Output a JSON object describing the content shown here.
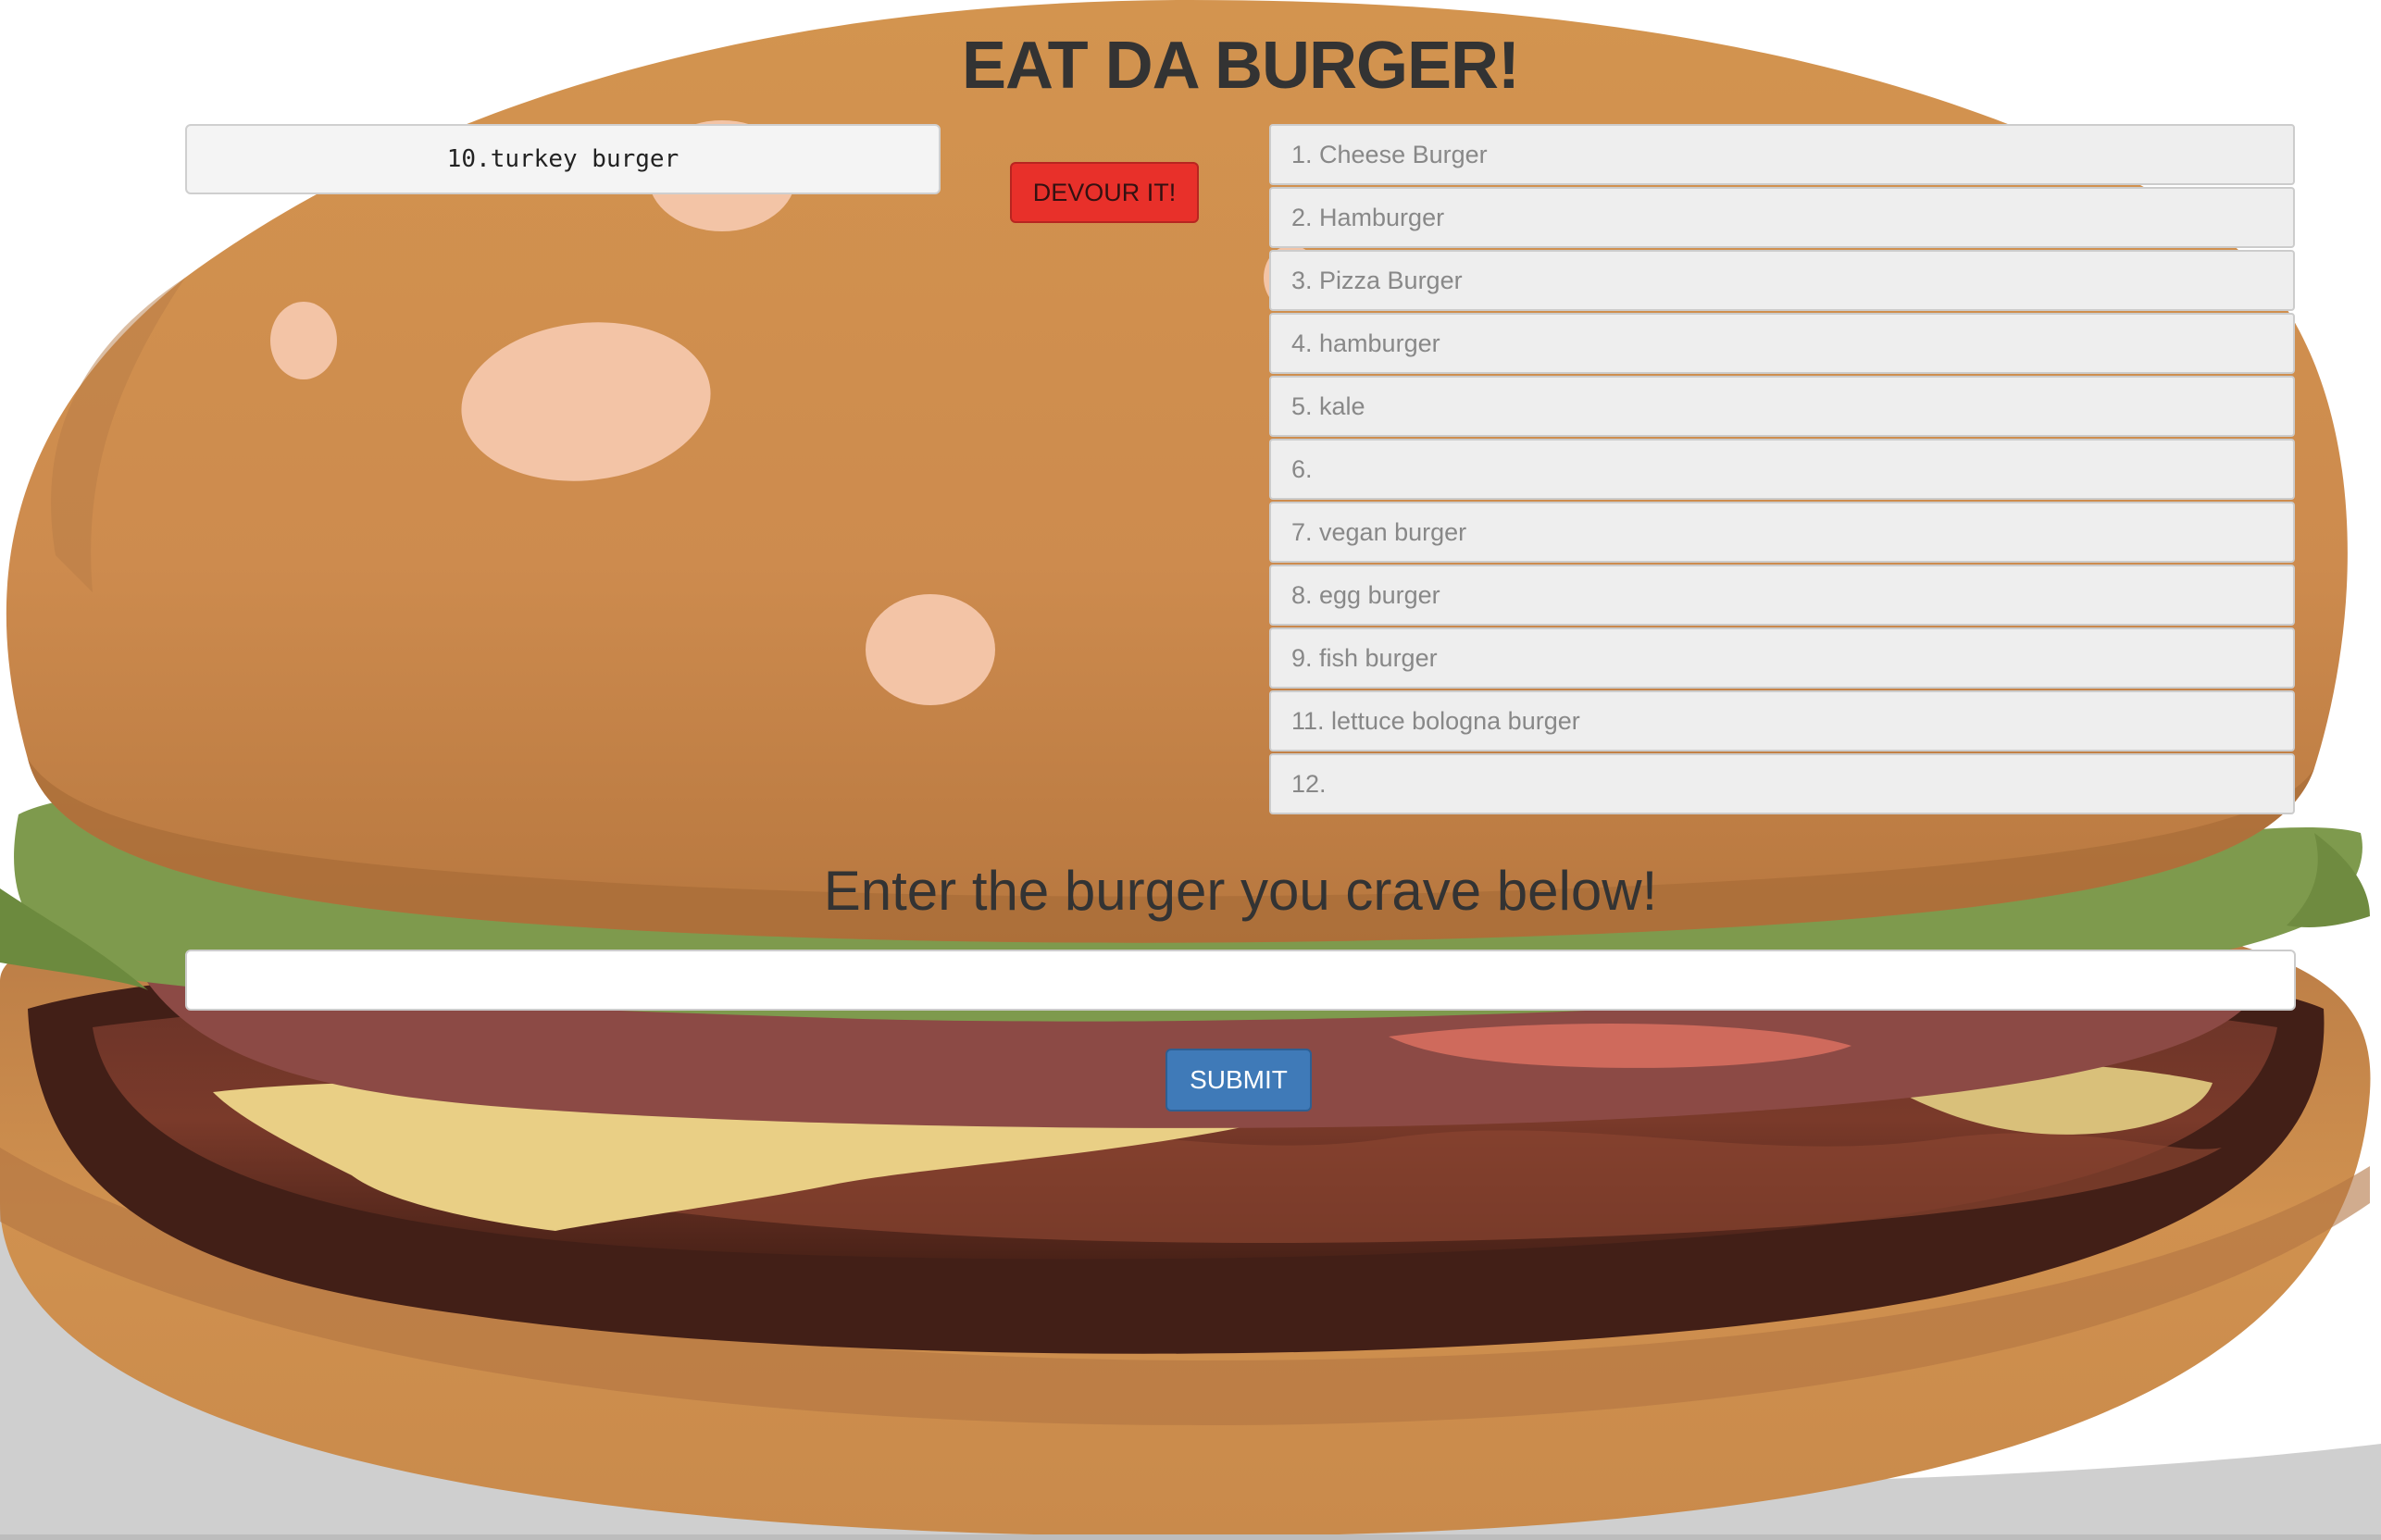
{
  "page": {
    "title": "EAT DA BURGER!"
  },
  "devoured": {
    "current": "10.turkey burger",
    "button_label": "DEVOUR IT!"
  },
  "burgers": [
    "1. Cheese Burger",
    "2. Hamburger",
    "3. Pizza Burger",
    "4. hamburger",
    "5. kale",
    "6.",
    "7. vegan burger",
    "8. egg burger",
    "9. fish burger",
    "11. lettuce bologna burger",
    "12."
  ],
  "form": {
    "heading": "Enter the burger you crave below!",
    "input_value": "",
    "submit_label": "SUBMIT"
  },
  "colors": {
    "bun": "#d1914f",
    "devour_button": "#e8302a",
    "submit_button": "#3f7ab8",
    "lettuce": "#7f9a4c",
    "patty": "#5a2a20"
  },
  "icons": [
    "hamburger-illustration"
  ]
}
